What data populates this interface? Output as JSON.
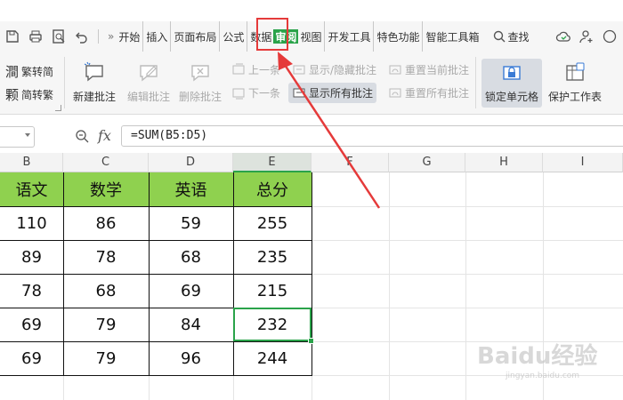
{
  "menubar": {
    "more_label": "»",
    "tabs": [
      {
        "label": "开始"
      },
      {
        "label": "插入"
      },
      {
        "label": "页面布局"
      },
      {
        "label": "公式"
      },
      {
        "label": "数据"
      },
      {
        "label": "审阅"
      },
      {
        "label": "视图"
      },
      {
        "label": "开发工具"
      },
      {
        "label": "特色功能"
      },
      {
        "label": "智能工具箱"
      }
    ],
    "active_tab": "审阅",
    "search_label": "查找",
    "accent_color": "#2aa34a",
    "highlight_color": "#e53a3a"
  },
  "ribbon": {
    "trad_to_simp": "繁转简",
    "simp_to_trad": "简转繁",
    "new_comment": "新建批注",
    "edit_comment": "编辑批注",
    "delete_comment": "删除批注",
    "prev": "上一条",
    "next": "下一条",
    "show_hide_comment": "显示/隐藏批注",
    "show_all_comments": "显示所有批注",
    "reset_current_comment": "重置当前批注",
    "reset_all_comments": "重置所有批注",
    "lock_cell": "锁定单元格",
    "protect_sheet": "保护工作表"
  },
  "formula_bar": {
    "fx_label": "fx",
    "formula": "=SUM(B5:D5)"
  },
  "columns": [
    "B",
    "C",
    "D",
    "E",
    "F",
    "G",
    "H",
    "I"
  ],
  "table": {
    "headers": [
      "语文",
      "数学",
      "英语",
      "总分"
    ],
    "rows": [
      [
        "110",
        "86",
        "59",
        "255"
      ],
      [
        "89",
        "78",
        "68",
        "235"
      ],
      [
        "78",
        "68",
        "69",
        "215"
      ],
      [
        "69",
        "79",
        "84",
        "232"
      ],
      [
        "69",
        "79",
        "96",
        "244"
      ]
    ],
    "header_color": "#8fd14f",
    "selected_cell": "E"
  },
  "watermark": {
    "brand": "Baidu经验",
    "url": "jingyan.baidu.com"
  }
}
